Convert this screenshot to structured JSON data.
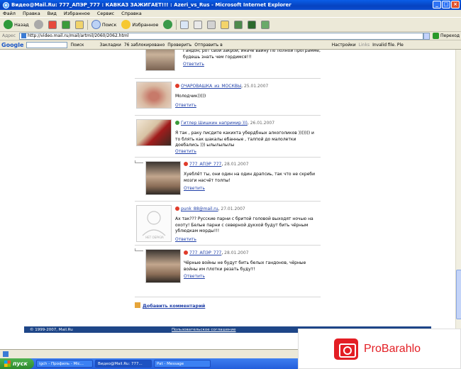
{
  "window": {
    "title": "Видео@Mail.Ru: 777_АПЭР_777 : КАВКАЗ ЗАЖИГАЕТ!!! : Azeri_vs_Rus - Microsoft Internet Explorer"
  },
  "menu": [
    "Файл",
    "Правка",
    "Вид",
    "Избранное",
    "Сервис",
    "Справка"
  ],
  "toolbar": {
    "back": "Назад",
    "search": "Поиск",
    "favorites": "Избранное"
  },
  "address": {
    "label": "Адрес",
    "url": "http://video.mail.ru/mail/artmil/2060/2062.html",
    "go": "Переход"
  },
  "google_bar": {
    "logo": "Google",
    "search": "Поиск",
    "blocked": "76 заблокировано",
    "bookmarks": "Закладки",
    "check": "Проверить",
    "send": "Отправить в",
    "settings": "Настройки",
    "links": "Links",
    "invalid": "Invalid file. Ple"
  },
  "comments": [
    {
      "text": "Гандон, рот свой закрой, иначе вайну по полной программе, будешь знать чем гордимся!!!",
      "reply": "Ответить"
    },
    {
      "author": "ОЧАРОВАШКА_из_МОСКВЫ",
      "date": "25.01.2007",
      "text": "Молодчик)))))",
      "reply": "Ответить"
    },
    {
      "author": "Гитлер Шишкин напримир )))",
      "date": "26.01.2007",
      "text": "Я так , раку писдите какихта убердбных алкоголиков ))))))) и то блять как шакалы ебанные , талпой до малолетки доебались ))) ылылылылы",
      "reply": "Ответить"
    },
    {
      "author": "777_АПЭР_777",
      "date": "28.01.2007",
      "text": "Хуеблёт ты, они один на один драпсиь, так что не скреби мозги насчёт толпы!",
      "reply": "Ответить"
    },
    {
      "author": "punk_88@mail.ru",
      "date": "27.01.2007",
      "avatar_caption": "НЕТ ОБРАЗА",
      "text": "Ах так??? Русские парни с бритой головой выходят ночью на охоту! Белые парни с северной дукхой будут бить чёрным ублюдкам морды!!!",
      "reply": "Ответить"
    },
    {
      "author": "777_АПЭР_777",
      "date": "28.01.2007",
      "text": "Чёрные войны не будут бить белых гандонов, чёрные войны им плотки резать будут!",
      "reply": "Ответить"
    }
  ],
  "add_comment": "Добавить комментарий",
  "footer": {
    "copyright": "© 1999-2007, Mail.Ru",
    "agreement": "Пользовательское соглашение"
  },
  "taskbar": {
    "start": "пуск",
    "tasks": [
      "igch - Профиль - Mic...",
      "Видео@Mail.Ru: 777...",
      "Pat - Message"
    ]
  },
  "watermark": "ProBarahlo"
}
